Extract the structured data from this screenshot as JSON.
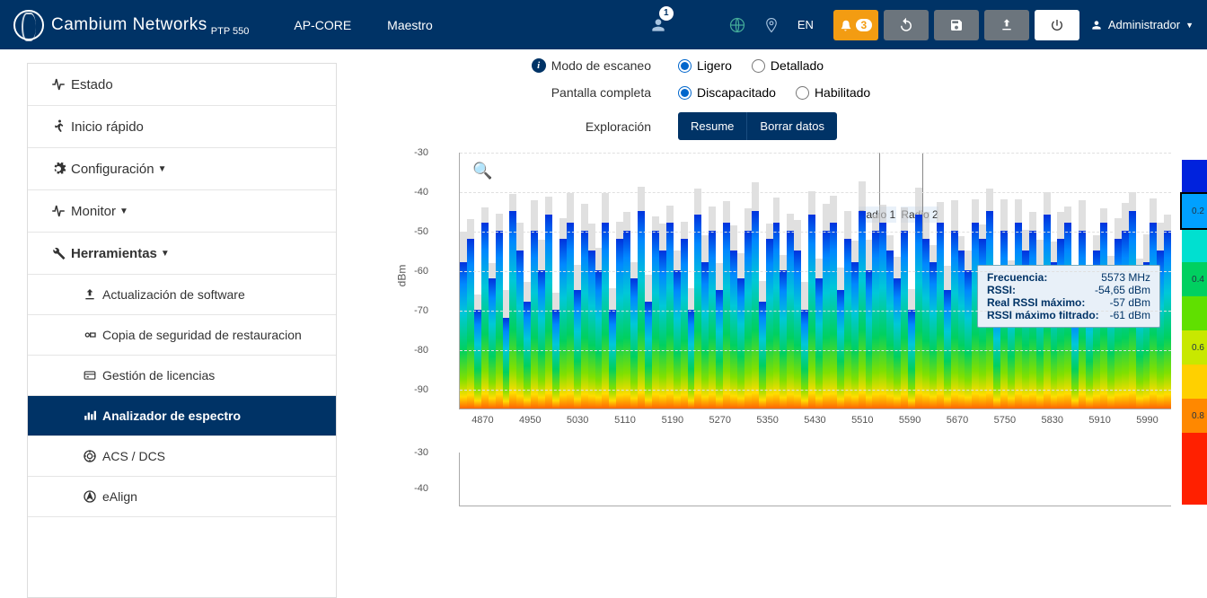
{
  "header": {
    "brand": "Cambium Networks",
    "model": "PTP 550",
    "crumbs": [
      "AP-CORE",
      "Maestro"
    ],
    "user_badge": "1",
    "lang": "EN",
    "notif_count": "3",
    "user": "Administrador"
  },
  "sidebar": {
    "items": [
      {
        "label": "Estado",
        "icon": "pulse"
      },
      {
        "label": "Inicio rápido",
        "icon": "run"
      },
      {
        "label": "Configuración",
        "icon": "gear",
        "caret": true
      },
      {
        "label": "Monitor",
        "icon": "pulse",
        "caret": true
      },
      {
        "label": "Herramientas",
        "icon": "wrench",
        "caret": true,
        "bold": true
      },
      {
        "label": "Actualización de software",
        "icon": "upload",
        "sub": true
      },
      {
        "label": "Copia de seguridad de restauracion",
        "icon": "backup",
        "sub": true
      },
      {
        "label": "Gestión de licencias",
        "icon": "card",
        "sub": true
      },
      {
        "label": "Analizador de espectro",
        "icon": "bars",
        "sub": true,
        "active": true
      },
      {
        "label": "ACS / DCS",
        "icon": "target",
        "sub": true
      },
      {
        "label": "eAlign",
        "icon": "align",
        "sub": true
      }
    ]
  },
  "controls": {
    "scan_mode_label": "Modo de escaneo",
    "scan_light": "Ligero",
    "scan_detail": "Detallado",
    "fullscreen_label": "Pantalla completa",
    "fs_disabled": "Discapacitado",
    "fs_enabled": "Habilitado",
    "explore_label": "Exploración",
    "btn_resume": "Resume",
    "btn_clear": "Borrar datos"
  },
  "chart_data": {
    "type": "area",
    "ylabel": "dBm",
    "ylim": [
      -95,
      -30
    ],
    "yticks": [
      -30,
      -40,
      -50,
      -60,
      -70,
      -80,
      -90
    ],
    "xticks": [
      4870,
      4950,
      5030,
      5110,
      5190,
      5270,
      5350,
      5430,
      5510,
      5590,
      5670,
      5750,
      5830,
      5910,
      5990
    ],
    "radio_markers": [
      "Radio 1",
      "Radio 2"
    ],
    "tooltip": {
      "freq_k": "Frecuencia:",
      "freq_v": "5573 MHz",
      "rssi_k": "RSSI:",
      "rssi_v": "-54,65 dBm",
      "real_k": "Real RSSI máximo:",
      "real_v": "-57 dBm",
      "filt_k": "RSSI máximo filtrado:",
      "filt_v": "-61 dBm"
    },
    "colorbar": [
      {
        "c": "#0022dd",
        "t": ""
      },
      {
        "c": "#00a0ff",
        "t": "0.2",
        "hl": true
      },
      {
        "c": "#00e0d0",
        "t": ""
      },
      {
        "c": "#00d060",
        "t": "0.4"
      },
      {
        "c": "#60e000",
        "t": ""
      },
      {
        "c": "#c8e800",
        "t": "0.6"
      },
      {
        "c": "#ffd000",
        "t": ""
      },
      {
        "c": "#ff8800",
        "t": "0.8"
      },
      {
        "c": "#ff2000",
        "t": ""
      }
    ],
    "chart2_yticks": [
      -30,
      -40
    ],
    "chart2_colorbar": [
      {
        "c": "#ff2000",
        "t": ""
      }
    ],
    "series_peaks": [
      -58,
      -52,
      -70,
      -48,
      -62,
      -50,
      -72,
      -45,
      -55,
      -68,
      -50,
      -60,
      -46,
      -70,
      -52,
      -48,
      -65,
      -50,
      -55,
      -60,
      -48,
      -70,
      -52,
      -50,
      -62,
      -45,
      -68,
      -50,
      -55,
      -48,
      -60,
      -52,
      -70,
      -46,
      -58,
      -50,
      -65,
      -48,
      -55,
      -62,
      -50,
      -45,
      -68,
      -52,
      -48,
      -60,
      -50,
      -55,
      -70,
      -46,
      -62,
      -50,
      -48,
      -65,
      -52,
      -58,
      -45,
      -60,
      -50,
      -48,
      -55,
      -62,
      -50,
      -70,
      -46,
      -52,
      -58,
      -48,
      -65,
      -50,
      -55,
      -60,
      -48,
      -52,
      -45,
      -68,
      -50,
      -62,
      -48,
      -55,
      -50,
      -60,
      -46,
      -58,
      -52,
      -48,
      -70,
      -50,
      -65,
      -55,
      -48,
      -60,
      -52,
      -50,
      -45,
      -62,
      -58,
      -48,
      -55,
      -50
    ]
  }
}
